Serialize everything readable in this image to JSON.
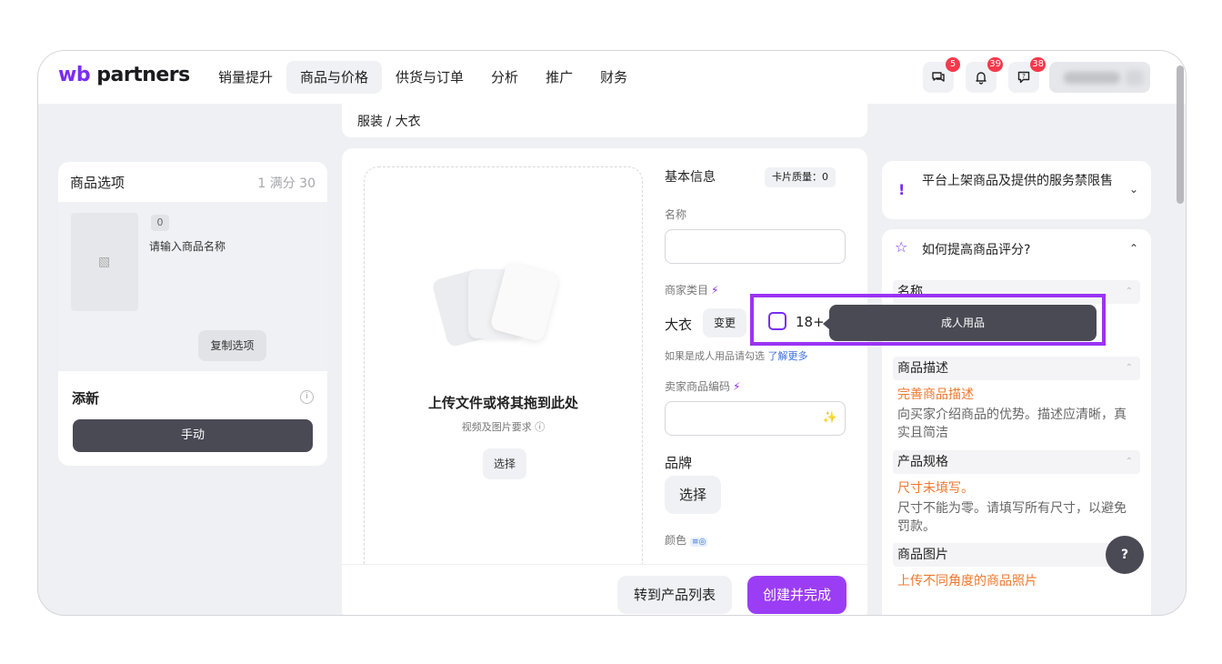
{
  "logo": {
    "wb": "wb",
    "partners": "partners"
  },
  "nav": [
    {
      "label": "销量提升"
    },
    {
      "label": "商品与价格"
    },
    {
      "label": "供货与订单"
    },
    {
      "label": "分析"
    },
    {
      "label": "推广"
    },
    {
      "label": "财务"
    }
  ],
  "badges": {
    "chat": "5",
    "notifications": "39",
    "support": "38"
  },
  "breadcrumb": "服装 / 大衣",
  "left_panel": {
    "title": "商品选项",
    "score": "1 满分 30",
    "item_count": "0",
    "item_name": "请输入商品名称",
    "copy_button": "复制选项",
    "add_title": "添新",
    "info_icon": "i",
    "manual_button": "手动"
  },
  "upload": {
    "title": "上传文件或将其拖到此处",
    "subtitle": "视频及图片要求 ⓘ",
    "select_button": "选择"
  },
  "form": {
    "section_title": "基本信息",
    "quality": "卡片质量：0",
    "name_label": "名称",
    "category_label": "商家类目",
    "category_value": "大衣",
    "change_button": "变更",
    "adult_checkbox_label": "18+",
    "adult_hint": "如果是成人用品请勾选",
    "learn_more": "了解更多",
    "seller_code_label": "卖家商品编码",
    "brand_label": "品牌",
    "brand_button": "选择",
    "color_label": "颜色",
    "go_to_list_button": "转到产品列表",
    "create_button": "创建并完成"
  },
  "tooltip": "成人用品",
  "right_panel": {
    "notice": "平台上架商品及提供的服务禁限售",
    "guide_title": "如何提高商品评分?",
    "sections": [
      {
        "title": "名称"
      },
      {
        "title": "商品描述",
        "warning": "完善商品描述",
        "desc": "向买家介绍商品的优势。描述应清晰，真实且简洁"
      },
      {
        "title": "产品规格",
        "warning": "尺寸未填写。",
        "desc": "尺寸不能为零。请填写所有尺寸，以避免罚款。"
      },
      {
        "title": "商品图片",
        "warning": "上传不同角度的商品照片"
      }
    ]
  },
  "help_button": "?",
  "colors": {
    "accent": "#9b3df5",
    "badge": "#f5384b",
    "warning": "#f0782f",
    "dark_button": "#4a4a55"
  },
  "icons": [
    "chat-icon",
    "bell-icon",
    "support-icon",
    "star-icon",
    "chevron-down-icon",
    "chevron-up-icon",
    "magic-wand-icon",
    "image-placeholder-icon"
  ]
}
